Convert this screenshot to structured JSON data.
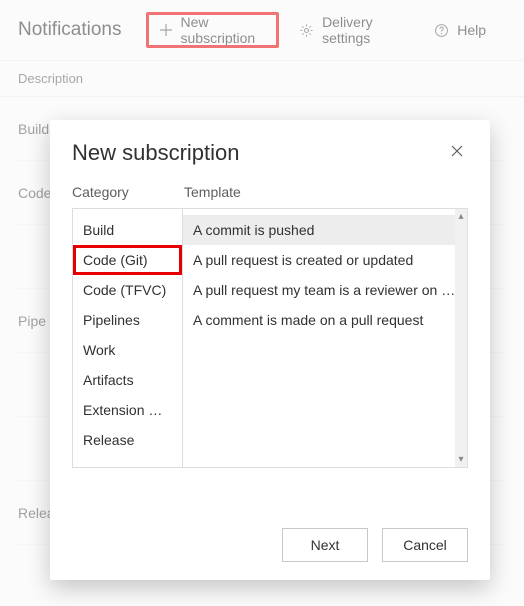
{
  "toolbar": {
    "title": "Notifications",
    "new_subscription_label": "New subscription",
    "delivery_settings_label": "Delivery settings",
    "help_label": "Help"
  },
  "table": {
    "description_header": "Description",
    "section_labels": [
      "Build",
      "Code",
      "Pipe",
      "Release"
    ]
  },
  "dialog": {
    "title": "New subscription",
    "category_header": "Category",
    "template_header": "Template",
    "categories": [
      {
        "label": "Build"
      },
      {
        "label": "Code (Git)"
      },
      {
        "label": "Code (TFVC)"
      },
      {
        "label": "Pipelines"
      },
      {
        "label": "Work"
      },
      {
        "label": "Artifacts"
      },
      {
        "label": "Extension …"
      },
      {
        "label": "Release"
      }
    ],
    "selected_category_index": 1,
    "templates": [
      {
        "label": "A commit is pushed"
      },
      {
        "label": "A pull request is created or updated"
      },
      {
        "label": "A pull request my team is a reviewer on …"
      },
      {
        "label": "A comment is made on a pull request"
      }
    ],
    "selected_template_index": 0,
    "next_label": "Next",
    "cancel_label": "Cancel"
  }
}
